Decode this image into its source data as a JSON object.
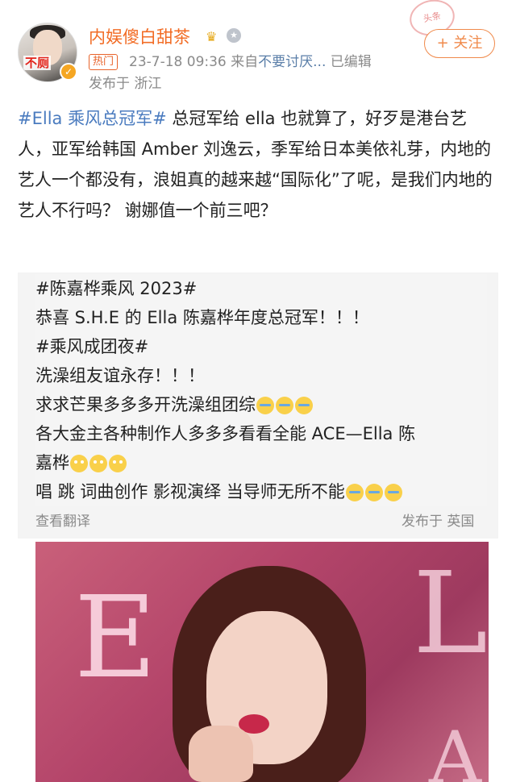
{
  "post": {
    "username": "内娱傻白甜茶",
    "avatar_tag": "不厕",
    "hot_label": "热门",
    "timestamp": "23-7-18 09:36",
    "source_prefix": "来自",
    "source": "不要讨厌...",
    "edited": "已编辑",
    "location": "发布于 浙江",
    "stamp": "头条",
    "follow_label": "+ 关注",
    "body": {
      "hashtag": "#Ella 乘风总冠军#",
      "text": " 总冠军给 ella 也就算了，好歹是港台艺人，亚军给韩国 Amber 刘逸云，季军给日本美依礼芽，内地的艺人一个都没有，浪姐真的越来越“国际化”了呢，是我们内地的艺人不行吗？ 谢娜值一个前三吧？"
    },
    "quoted": {
      "hashtag1": "#陈嘉桦乘风 2023#",
      "line1": "恭喜 S.H.E 的 Ella 陈嘉桦年度总冠军！！！",
      "hashtag2": "#乘风成团夜#",
      "line2": "洗澡组友谊永存！！！",
      "line3": "求求芒果多多多开洗澡组团综",
      "line4": "各大金主各种制作人多多多看看全能 ACE—Ella 陈",
      "line5": "嘉桦",
      "line6": "唱 跳 词曲创作 影视演绎 当导师无所不能",
      "translate": "查看翻译",
      "posted_in": "发布于 英国"
    }
  },
  "icons": {
    "crown": "crown-icon",
    "medal": "medal-icon",
    "verified": "verified-icon",
    "emoji_cry": "crying-face-emoji",
    "emoji_roll": "eye-roll-emoji"
  },
  "colors": {
    "username": "#f26c25",
    "hashtag": "#4a7bbf",
    "follow": "#f08a4b",
    "meta": "#8a8a8a"
  }
}
